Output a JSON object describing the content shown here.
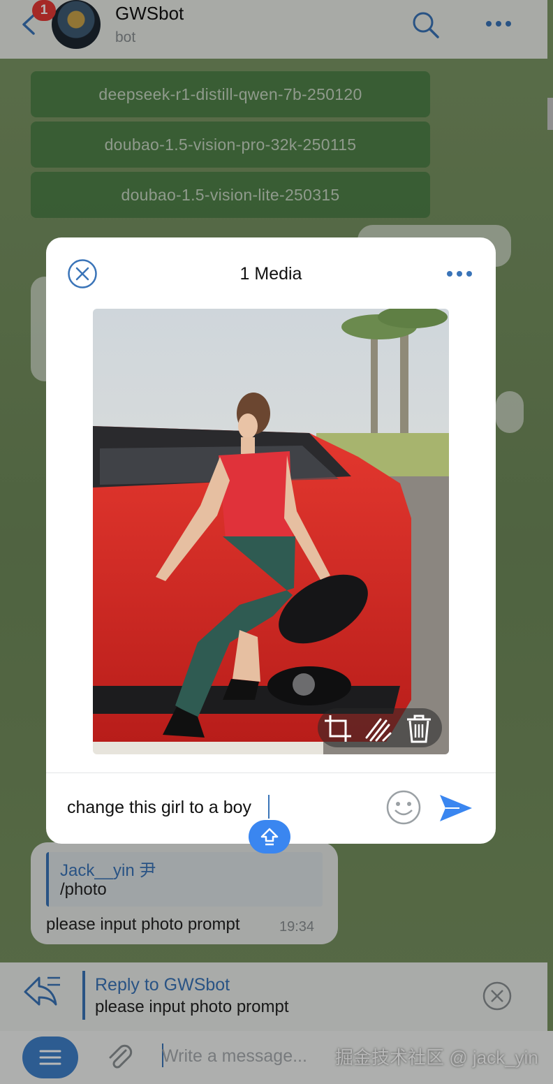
{
  "header": {
    "back_icon": "chevron-left-icon",
    "unread_badge": "1",
    "bot_name": "GWSbot",
    "bot_subtitle": "bot"
  },
  "keyboard_buttons": [
    "deepseek-r1-distill-qwen-7b-250120",
    "doubao-1.5-vision-pro-32k-250115",
    "doubao-1.5-vision-lite-250315"
  ],
  "message": {
    "quote_name": "Jack__yin 尹",
    "quote_text": "/photo",
    "text": "please input photo prompt",
    "time": "19:34"
  },
  "reply_bar": {
    "title": "Reply to GWSbot",
    "text": "please input photo prompt"
  },
  "composer": {
    "placeholder": "Write a message..."
  },
  "watermark": "掘金技术社区 @ jack_yin",
  "modal": {
    "title": "1 Media",
    "caption": "change this girl to a boy",
    "accent": "#3a74b8"
  }
}
